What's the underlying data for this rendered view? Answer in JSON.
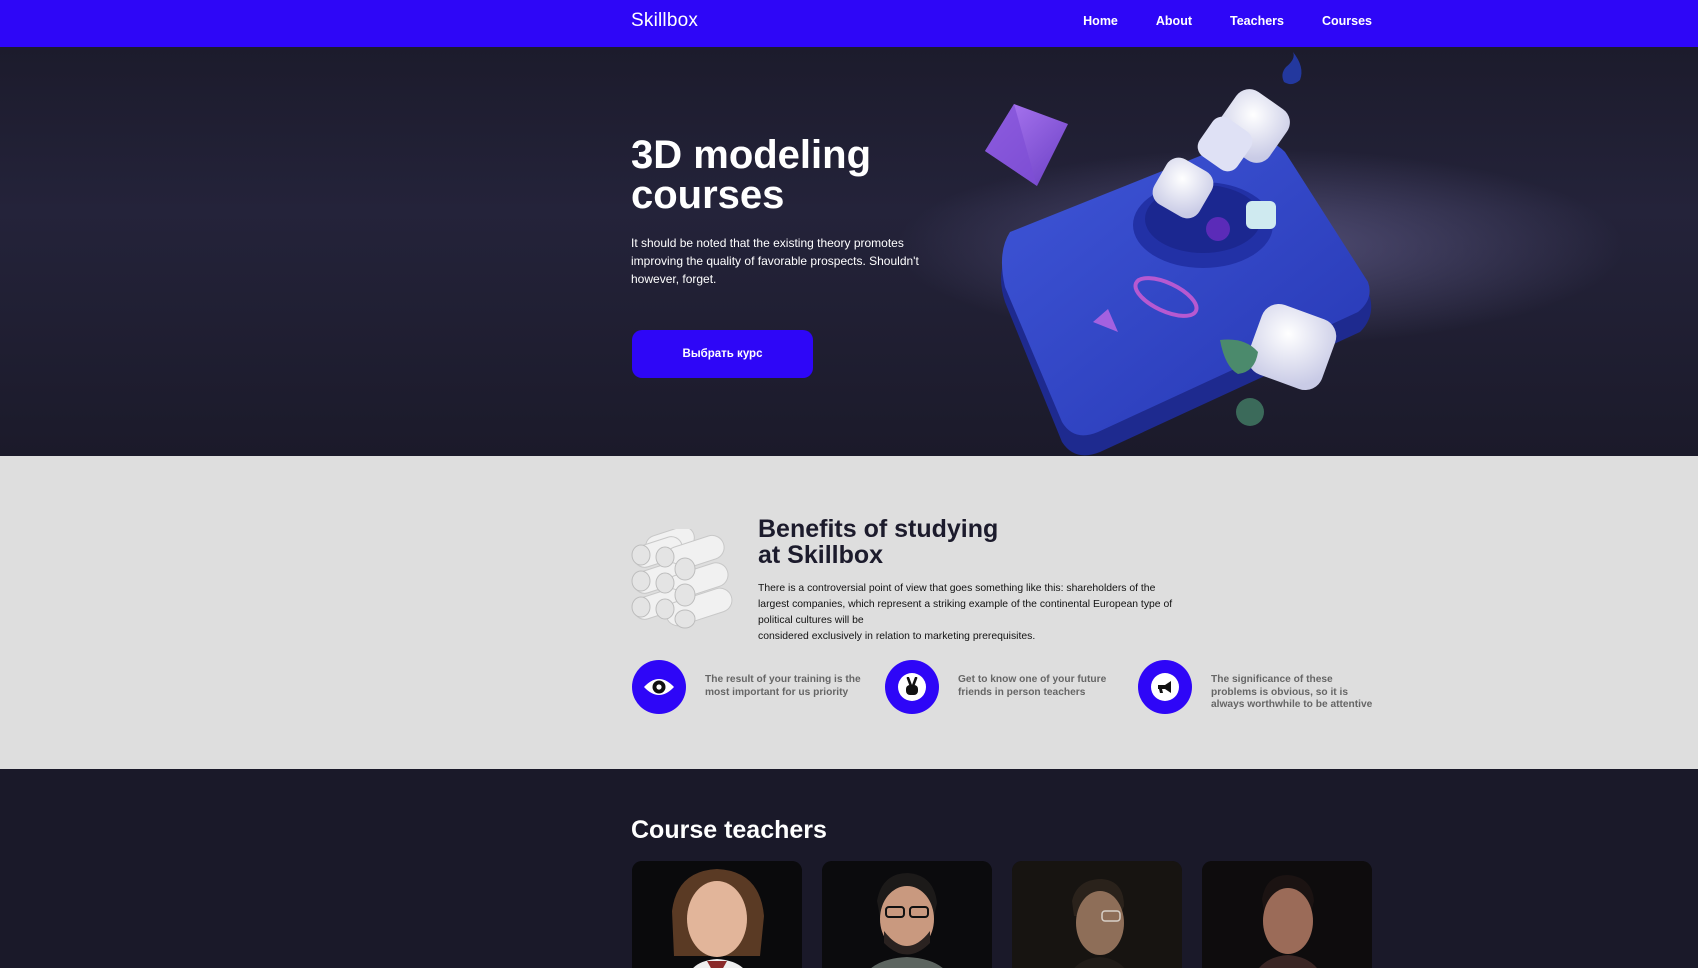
{
  "header": {
    "logo": "Skillbox",
    "nav": [
      "Home",
      "About",
      "Teachers",
      "Courses"
    ]
  },
  "hero": {
    "title_line1": "3D modeling",
    "title_line2": "courses",
    "text": "It should be noted that the existing theory promotes improving the quality of favorable prospects. Shouldn't however, forget.",
    "button_label": "Выбрать курс",
    "illustration_icon": "3d-platform-illustration"
  },
  "benefits": {
    "title_line1": "Benefits of studying",
    "title_line2": "at Skillbox",
    "text_line1": "There is a controversial point of view that goes something like this: shareholders of the largest companies, which represent a striking example of the continental European type of political cultures will be",
    "text_line2": "considered exclusively in relation to marketing prerequisites.",
    "decor_icon": "cylinders-illustration",
    "features": [
      {
        "icon": "eye-icon",
        "text": "The result of your training is the most important for us priority"
      },
      {
        "icon": "victory-hand-icon",
        "text": "Get to know one of your future friends in person teachers"
      },
      {
        "icon": "megaphone-icon",
        "text": "The significance of these problems is obvious, so it is always worthwhile to be attentive"
      }
    ]
  },
  "teachers": {
    "title": "Course teachers",
    "photos": [
      "teacher-photo-1",
      "teacher-photo-2",
      "teacher-photo-3",
      "teacher-photo-4"
    ]
  },
  "colors": {
    "brand": "#2e06f7",
    "dark_bg": "#1a1929",
    "light_bg": "#dedede"
  }
}
